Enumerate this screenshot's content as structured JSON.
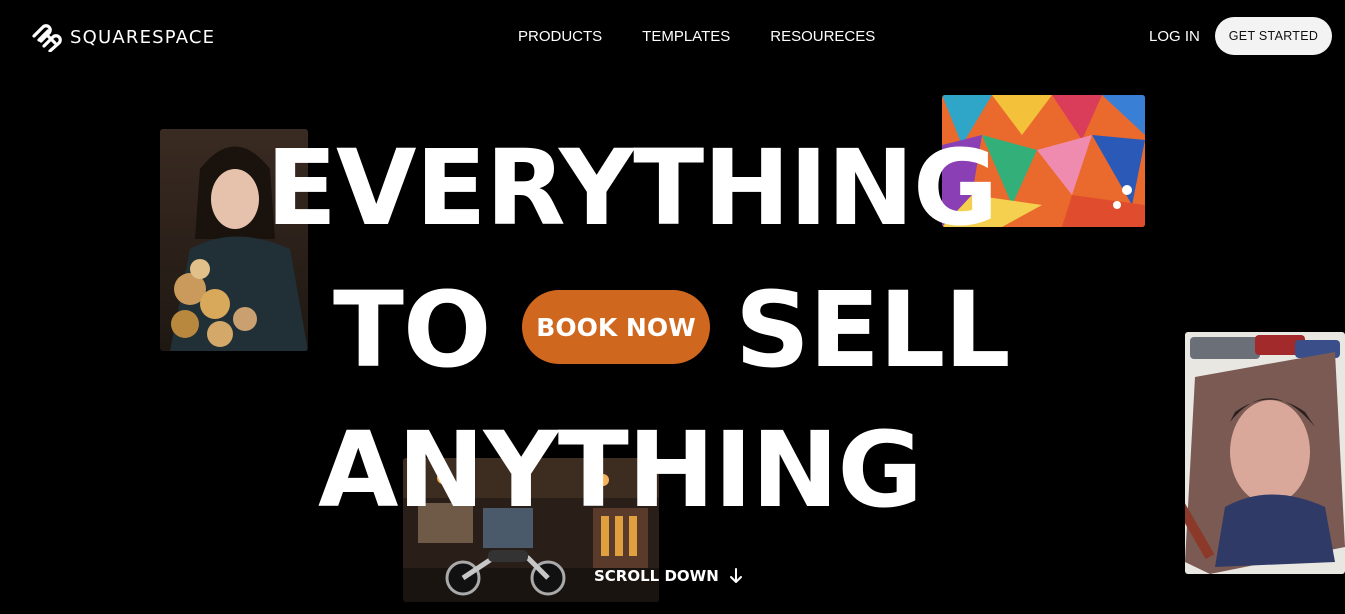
{
  "header": {
    "brand": "SQUARESPACE",
    "nav": [
      "PRODUCTS",
      "TEMPLATES",
      "RESOURECES"
    ],
    "login": "LOG IN",
    "cta": "GET STARTED"
  },
  "hero": {
    "line1": "EVERYTHING",
    "line2_left": "TO",
    "line2_right": "SELL",
    "line3": "ANYTHING",
    "book_now": "BOOK NOW",
    "scroll_down": "SCROLL DOWN"
  },
  "colors": {
    "background": "#000000",
    "accent": "#d0671f",
    "cta_bg": "#f3f3f3"
  },
  "icons": [
    "squarespace-logo-icon",
    "arrow-down-icon"
  ]
}
